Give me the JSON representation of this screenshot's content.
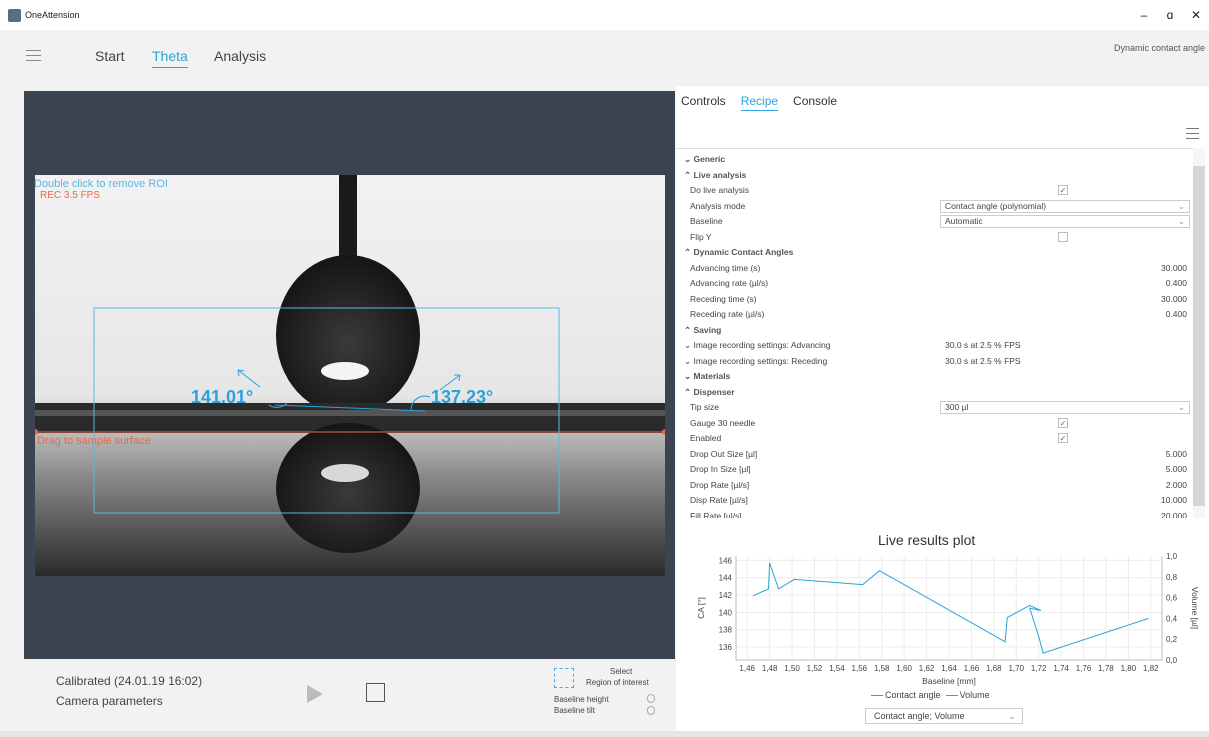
{
  "window": {
    "title": "OneAttension",
    "minimize": "–",
    "maximize": "ɑ",
    "close": "✕"
  },
  "nav": {
    "tabs": [
      "Start",
      "Theta",
      "Analysis"
    ],
    "active": "Theta",
    "mode": "Dynamic contact angle"
  },
  "camera": {
    "roi_hint": "Double click to remove ROI",
    "rec": "REC 3.5 FPS",
    "drag_hint": "Drag to sample surface.",
    "angle_left": "141.01°",
    "angle_right": "137.23°",
    "calibrated": "Calibrated (24.01.19 16:02)",
    "camera_parameters": "Camera parameters",
    "select": "Select",
    "region_of_interest": "Region of interest",
    "baseline_height": "Baseline height",
    "baseline_tilt": "Baseline tilt"
  },
  "panel": {
    "tabs": [
      "Controls",
      "Recipe",
      "Console"
    ],
    "active": "Recipe"
  },
  "recipe": {
    "rows": [
      {
        "type": "section",
        "label": "Generic",
        "collapsed": true
      },
      {
        "type": "section",
        "label": "Live analysis",
        "collapsed": false
      },
      {
        "type": "check",
        "label": "Do live analysis",
        "checked": true
      },
      {
        "type": "select",
        "label": "Analysis mode",
        "value": "Contact angle (polynomial)"
      },
      {
        "type": "select",
        "label": "Baseline",
        "value": "Automatic"
      },
      {
        "type": "check",
        "label": "Flip Y",
        "checked": false
      },
      {
        "type": "section",
        "label": "Dynamic Contact Angles",
        "collapsed": false
      },
      {
        "type": "number",
        "label": "Advancing time (s)",
        "value": "30.000"
      },
      {
        "type": "number",
        "label": "Advancing rate (µl/s)",
        "value": "0.400"
      },
      {
        "type": "number",
        "label": "Receding time (s)",
        "value": "30.000"
      },
      {
        "type": "number",
        "label": "Receding rate (µl/s)",
        "value": "0.400"
      },
      {
        "type": "section",
        "label": "Saving",
        "collapsed": false
      },
      {
        "type": "text",
        "label": "Image recording settings: Advancing",
        "value": "30.0 s at 2.5 % FPS",
        "collapsed": true
      },
      {
        "type": "text",
        "label": "Image recording settings: Receding",
        "value": "30.0 s at 2.5 % FPS",
        "collapsed": true
      },
      {
        "type": "section",
        "label": "Materials",
        "collapsed": true
      },
      {
        "type": "section",
        "label": "Dispenser",
        "collapsed": false
      },
      {
        "type": "select",
        "label": "Tip size",
        "value": "300 µl"
      },
      {
        "type": "check",
        "label": "Gauge 30 needle",
        "checked": true
      },
      {
        "type": "check",
        "label": "Enabled",
        "checked": true
      },
      {
        "type": "number",
        "label": "Drop Out Size [µl]",
        "value": "5.000"
      },
      {
        "type": "number",
        "label": "Drop In Size [µl]",
        "value": "5.000"
      },
      {
        "type": "number",
        "label": "Drop Rate [µl/s]",
        "value": "2.000"
      },
      {
        "type": "number",
        "label": "Disp Rate [µl/s]",
        "value": "10.000"
      },
      {
        "type": "number",
        "label": "Fill Rate [µl/s]",
        "value": "20.000"
      }
    ]
  },
  "plot": {
    "title": "Live results plot",
    "legend": [
      "Contact angle",
      "Volume"
    ],
    "selector": "Contact angle; Volume"
  },
  "chart_data": {
    "type": "line",
    "title": "Live results plot",
    "xlabel": "Baseline [mm]",
    "ylabel": "CA [°]",
    "y2label": "Volume [µl]",
    "xlim": [
      1.45,
      1.83
    ],
    "ylim": [
      134.5,
      146.5
    ],
    "y2lim": [
      0,
      1.0
    ],
    "xticks": [
      "1,46",
      "1,48",
      "1,50",
      "1,52",
      "1,54",
      "1,56",
      "1,58",
      "1,60",
      "1,62",
      "1,64",
      "1,66",
      "1,68",
      "1,70",
      "1,72",
      "1,74",
      "1,76",
      "1,78",
      "1,80",
      "1,82"
    ],
    "yticks": [
      "136",
      "138",
      "140",
      "142",
      "144",
      "146"
    ],
    "y2ticks": [
      "0,0",
      "0,2",
      "0,4",
      "0,6",
      "0,8",
      "1,0"
    ],
    "series": [
      {
        "name": "Contact angle",
        "color": "#2aa3dc",
        "x": [
          1.465,
          1.479,
          1.48,
          1.488,
          1.502,
          1.563,
          1.578,
          1.69,
          1.692,
          1.712,
          1.722,
          1.712,
          1.72,
          1.724,
          1.818
        ],
        "y": [
          141.9,
          142.7,
          145.7,
          142.7,
          143.8,
          143.2,
          144.8,
          136.6,
          139.4,
          140.8,
          140.2,
          140.5,
          137.2,
          135.3,
          139.3
        ]
      }
    ]
  }
}
